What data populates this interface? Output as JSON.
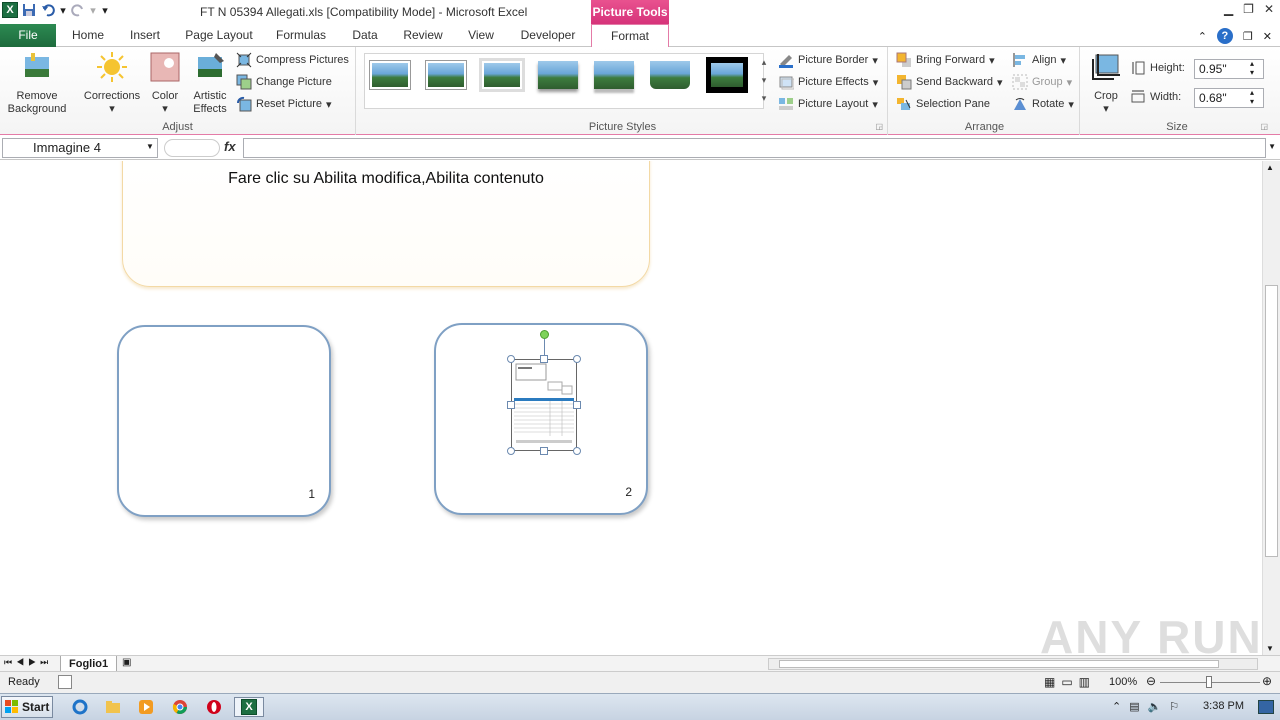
{
  "titlebar": {
    "title": "FT N 05394 Allegati.xls  [Compatibility Mode]  -  Microsoft Excel",
    "context_tab": "Picture Tools"
  },
  "tabs": [
    {
      "label": "File"
    },
    {
      "label": "Home"
    },
    {
      "label": "Insert"
    },
    {
      "label": "Page Layout"
    },
    {
      "label": "Formulas"
    },
    {
      "label": "Data"
    },
    {
      "label": "Review"
    },
    {
      "label": "View"
    },
    {
      "label": "Developer"
    },
    {
      "label": "Format"
    }
  ],
  "ribbon": {
    "adjust": {
      "label": "Adjust",
      "remove_bg_1": "Remove",
      "remove_bg_2": "Background",
      "corrections": "Corrections",
      "color": "Color",
      "artistic_1": "Artistic",
      "artistic_2": "Effects",
      "compress": "Compress Pictures",
      "change": "Change Picture",
      "reset": "Reset Picture"
    },
    "styles": {
      "label": "Picture Styles",
      "border": "Picture Border",
      "effects": "Picture Effects",
      "layout": "Picture Layout"
    },
    "arrange": {
      "label": "Arrange",
      "bring_forward": "Bring Forward",
      "send_backward": "Send Backward",
      "selection_pane": "Selection Pane",
      "align": "Align",
      "group": "Group",
      "rotate": "Rotate"
    },
    "size": {
      "label": "Size",
      "crop": "Crop",
      "height_label": "Height:",
      "height_value": "0.95\"",
      "width_label": "Width:",
      "width_value": "0.68\""
    }
  },
  "formula_bar": {
    "name_box": "Immagine 4",
    "fx": "fx",
    "value": ""
  },
  "sheet": {
    "banner_text": "Fare clic su Abilita modifica,Abilita contenuto",
    "card1_number": "1",
    "card2_number": "2",
    "sheet_tab": "Foglio1"
  },
  "status": {
    "ready": "Ready",
    "zoom": "100%"
  },
  "taskbar": {
    "start": "Start",
    "clock": "3:38 PM"
  },
  "watermark": "ANY RUN",
  "colors": {
    "file_tab": "#1e6b3d",
    "context_tab": "#d6337a",
    "card_border": "#7fa0c4"
  }
}
